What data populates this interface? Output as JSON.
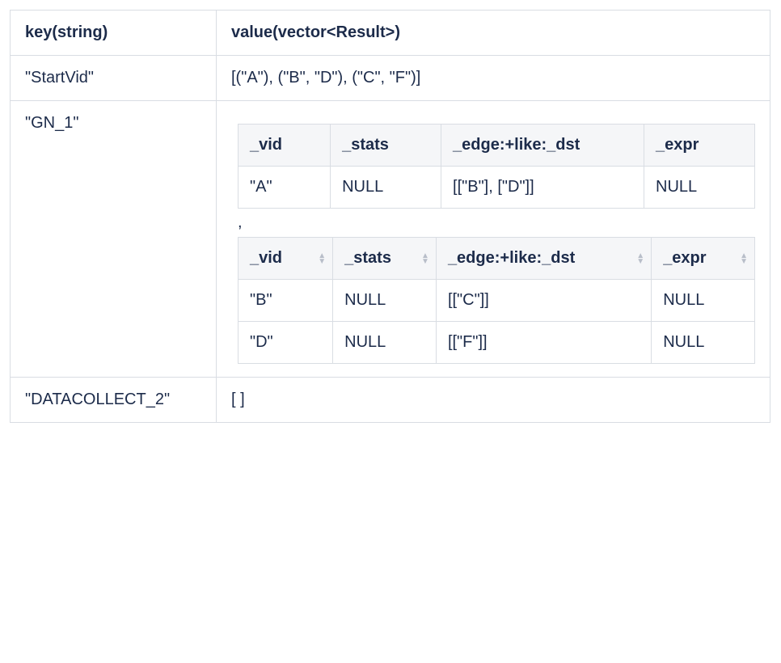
{
  "outer": {
    "headers": {
      "key": "key(string)",
      "value": "value(vector<Result>)"
    },
    "rows": {
      "startvid": {
        "key": "\"StartVid\"",
        "value": "[(\"A\"),  (\"B\", \"D\"), (\"C\", \"F\")]"
      },
      "gn1": {
        "key": "\"GN_1\""
      },
      "datacollect": {
        "key": "\"DATACOLLECT_2\"",
        "value": "[ ]"
      }
    }
  },
  "gn1_separator": ",",
  "inner1": {
    "headers": {
      "vid": "_vid",
      "stats": "_stats",
      "edge": "_edge:+like:_dst",
      "expr": "_expr"
    },
    "rows": [
      {
        "vid": "\"A\"",
        "stats": "NULL",
        "edge": "[[\"B\"], [\"D\"]]",
        "expr": "NULL"
      }
    ]
  },
  "inner2": {
    "headers": {
      "vid": "_vid",
      "stats": "_stats",
      "edge": "_edge:+like:_dst",
      "expr": "_expr"
    },
    "rows": [
      {
        "vid": "\"B\"",
        "stats": "NULL",
        "edge": "[[\"C\"]]",
        "expr": "NULL"
      },
      {
        "vid": "\"D\"",
        "stats": "NULL",
        "edge": "[[\"F\"]]",
        "expr": "NULL"
      }
    ]
  }
}
